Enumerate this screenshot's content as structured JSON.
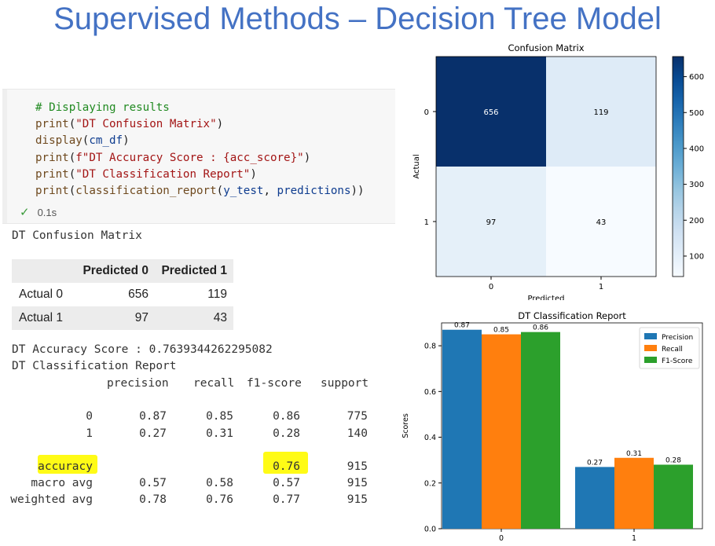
{
  "slide": {
    "title": "Supervised Methods – Decision Tree Model"
  },
  "code_cell": {
    "lines": [
      "# Displaying results",
      "print(\"DT Confusion Matrix\")",
      "display(cm_df)",
      "print(f\"DT Accuracy Score : {acc_score}\")",
      "print(\"DT Classification Report\")",
      "print(classification_report(y_test, predictions))"
    ],
    "status_time": "0.1s"
  },
  "output": {
    "cm_heading": "DT Confusion Matrix",
    "cm_table": {
      "columns": [
        "",
        "Predicted 0",
        "Predicted 1"
      ],
      "rows": [
        {
          "label": "Actual 0",
          "values": [
            "656",
            "119"
          ]
        },
        {
          "label": "Actual 1",
          "values": [
            "97",
            "43"
          ]
        }
      ]
    },
    "accuracy_line": "DT Accuracy Score : 0.7639344262295082",
    "report_heading": "DT Classification Report",
    "report": {
      "header": [
        "precision",
        "recall",
        "f1-score",
        "support"
      ],
      "rows": [
        {
          "label": "0",
          "values": [
            "0.87",
            "0.85",
            "0.86",
            "775"
          ]
        },
        {
          "label": "1",
          "values": [
            "0.27",
            "0.31",
            "0.28",
            "140"
          ]
        },
        {
          "label": "accuracy",
          "values": [
            "",
            "",
            "0.76",
            "915"
          ]
        },
        {
          "label": "macro avg",
          "values": [
            "0.57",
            "0.58",
            "0.57",
            "915"
          ]
        },
        {
          "label": "weighted avg",
          "values": [
            "0.78",
            "0.76",
            "0.77",
            "915"
          ]
        }
      ]
    },
    "highlight_color": "#fffb16"
  },
  "chart_data": [
    {
      "type": "heatmap",
      "title": "Confusion Matrix",
      "xlabel": "Predicted",
      "ylabel": "Actual",
      "x_categories": [
        "0",
        "1"
      ],
      "y_categories": [
        "0",
        "1"
      ],
      "values": [
        [
          656,
          119
        ],
        [
          97,
          43
        ]
      ],
      "colorbar": {
        "ticks": [
          100,
          200,
          300,
          400,
          500,
          600
        ],
        "range": [
          43,
          656
        ],
        "colormap": "Blues"
      }
    },
    {
      "type": "bar",
      "title": "DT Classification Report",
      "xlabel": "",
      "ylabel": "Scores",
      "categories": [
        "0",
        "1"
      ],
      "ylim": [
        0,
        0.9
      ],
      "yticks": [
        "0.0",
        "0.2",
        "0.4",
        "0.6",
        "0.8"
      ],
      "legend": "top-right",
      "series": [
        {
          "name": "Precision",
          "color": "#1f77b4",
          "values": [
            0.87,
            0.27
          ]
        },
        {
          "name": "Recall",
          "color": "#ff7f0e",
          "values": [
            0.85,
            0.31
          ]
        },
        {
          "name": "F1-Score",
          "color": "#2ca02c",
          "values": [
            0.86,
            0.28
          ]
        }
      ]
    }
  ]
}
